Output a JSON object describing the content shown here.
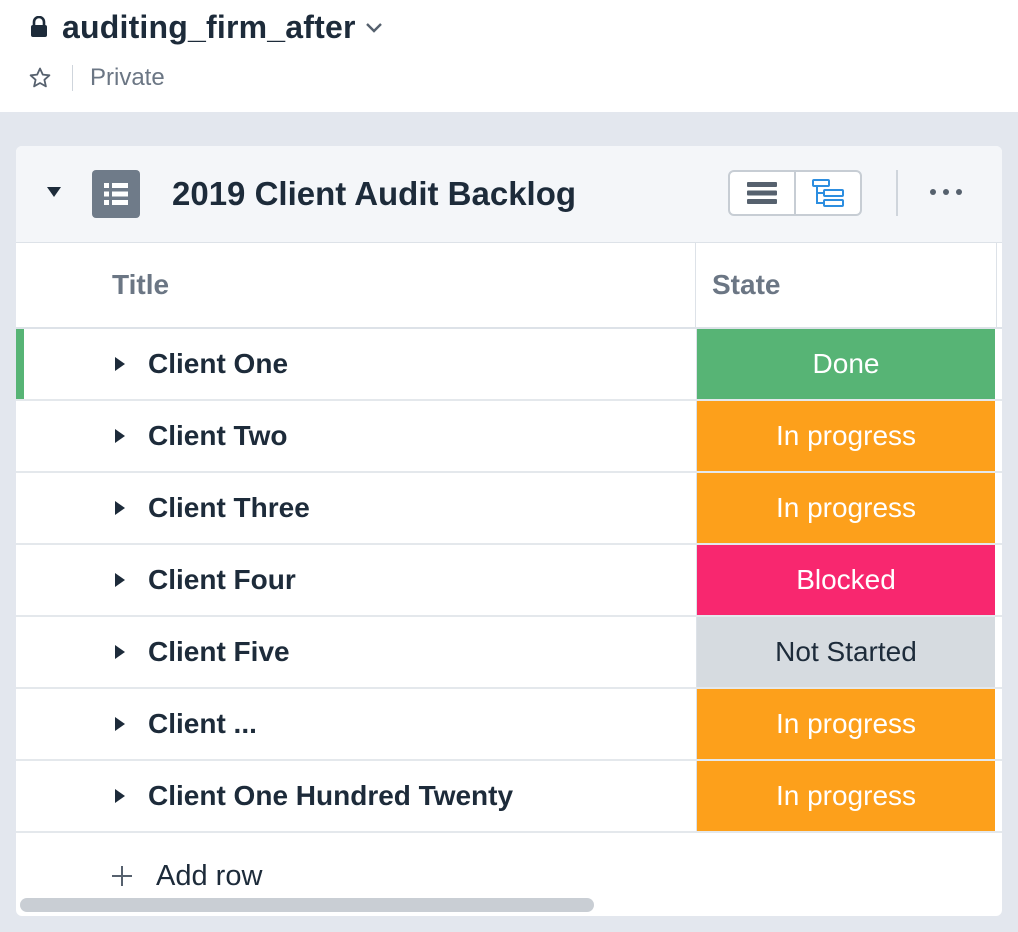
{
  "doc": {
    "title": "auditing_firm_after",
    "visibility": "Private"
  },
  "card": {
    "title": "2019 Client Audit Backlog"
  },
  "table": {
    "columns": [
      "Title",
      "State"
    ],
    "rows": [
      {
        "title": "Client One",
        "state": "Done",
        "state_color": "#57b475"
      },
      {
        "title": "Client Two",
        "state": "In progress",
        "state_color": "#fda01b"
      },
      {
        "title": "Client Three",
        "state": "In progress",
        "state_color": "#fda01b"
      },
      {
        "title": "Client Four",
        "state": "Blocked",
        "state_color": "#f8276f"
      },
      {
        "title": "Client Five",
        "state": "Not Started",
        "state_color": "#d6dbe0"
      },
      {
        "title": "Client ...",
        "state": "In progress",
        "state_color": "#fda01b"
      },
      {
        "title": "Client One Hundred Twenty",
        "state": "In progress",
        "state_color": "#fda01b"
      }
    ],
    "add_row_label": "Add row"
  },
  "icons": {
    "lock": "lock-icon",
    "chevron": "chevron-down-icon",
    "star": "star-icon",
    "collapse": "triangle-down-icon",
    "table": "table-icon",
    "list_view": "list-view-icon",
    "tree_view": "hierarchy-view-icon",
    "more": "more-horizontal-icon",
    "expand": "triangle-right-icon",
    "add": "plus-icon"
  },
  "colors": {
    "done": "#57b475",
    "in_progress": "#fda01b",
    "blocked": "#f8276f",
    "not_started": "#d6dbe0",
    "accent": "#2d8ee0"
  }
}
